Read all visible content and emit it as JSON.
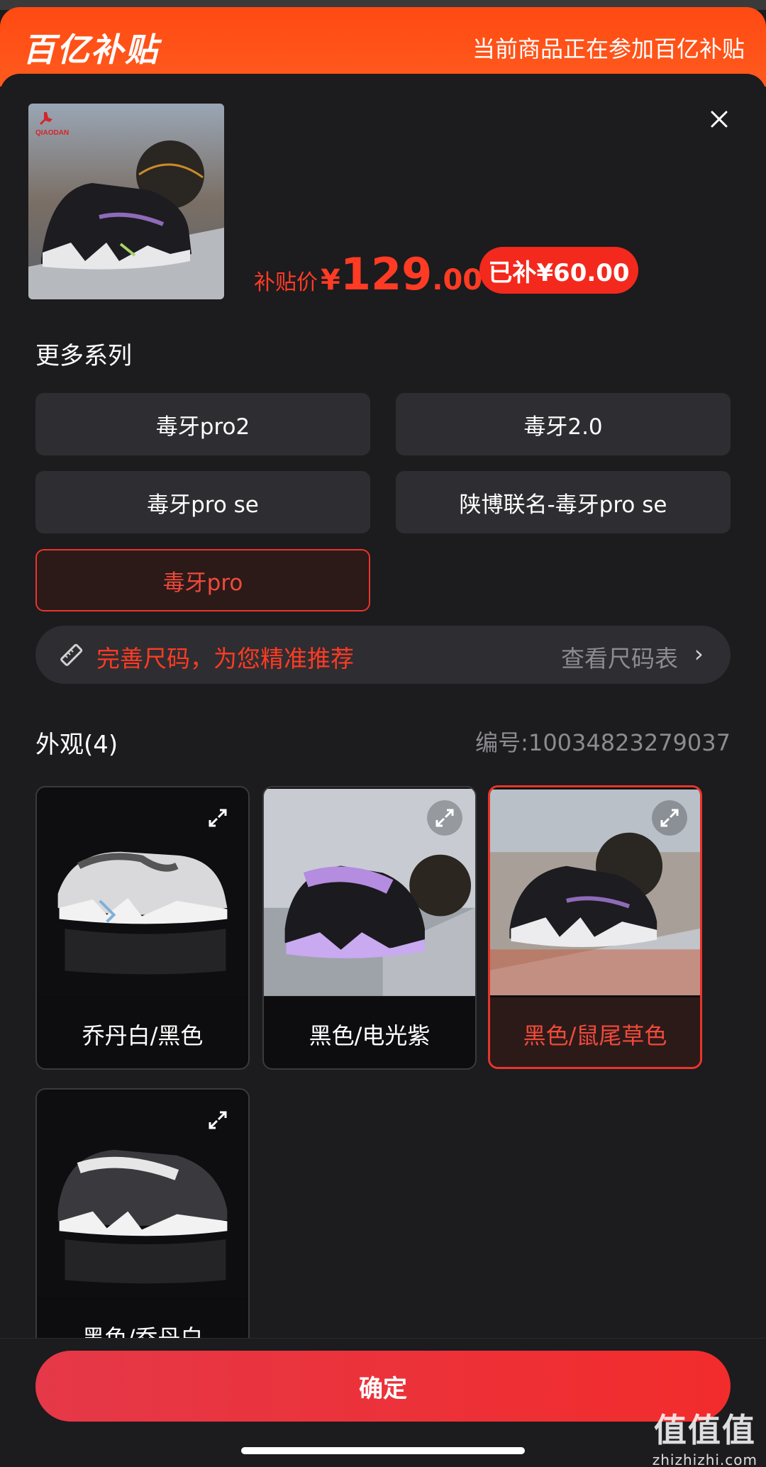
{
  "banner": {
    "brand": "百亿补贴",
    "notice": "当前商品正在参加百亿补贴"
  },
  "product": {
    "price_label": "补贴价",
    "currency": "¥",
    "price_int": "129",
    "price_dec": ".00",
    "saved_label": "已补¥60.00",
    "image_icon": "sneaker-photo",
    "logo_text": "QIAODAN"
  },
  "series": {
    "title": "更多系列",
    "items": [
      {
        "label": "毒牙pro2",
        "selected": false
      },
      {
        "label": "毒牙2.0",
        "selected": false
      },
      {
        "label": "毒牙pro se",
        "selected": false
      },
      {
        "label": "陕博联名-毒牙pro se",
        "selected": false
      },
      {
        "label": "毒牙pro",
        "selected": true
      }
    ]
  },
  "size_bar": {
    "tip": "完善尺码，为您精准推荐",
    "chart_link": "查看尺码表",
    "chevron": "›"
  },
  "appearance": {
    "title": "外观(4)",
    "id_label": "编号:10034823279037",
    "items": [
      {
        "name": "乔丹白/黑色",
        "selected": false
      },
      {
        "name": "黑色/电光紫",
        "selected": false
      },
      {
        "name": "黑色/鼠尾草色",
        "selected": true
      },
      {
        "name": "黑色/乔丹白",
        "selected": false
      }
    ]
  },
  "footer": {
    "confirm_label": "确定"
  },
  "watermark": {
    "big": "值值值",
    "small": "zhizhizhi.com"
  },
  "colors": {
    "accent": "#ff3b24",
    "banner": "#ff4a12",
    "background": "#1c1b1e",
    "button_bg": "#2e2d31"
  }
}
